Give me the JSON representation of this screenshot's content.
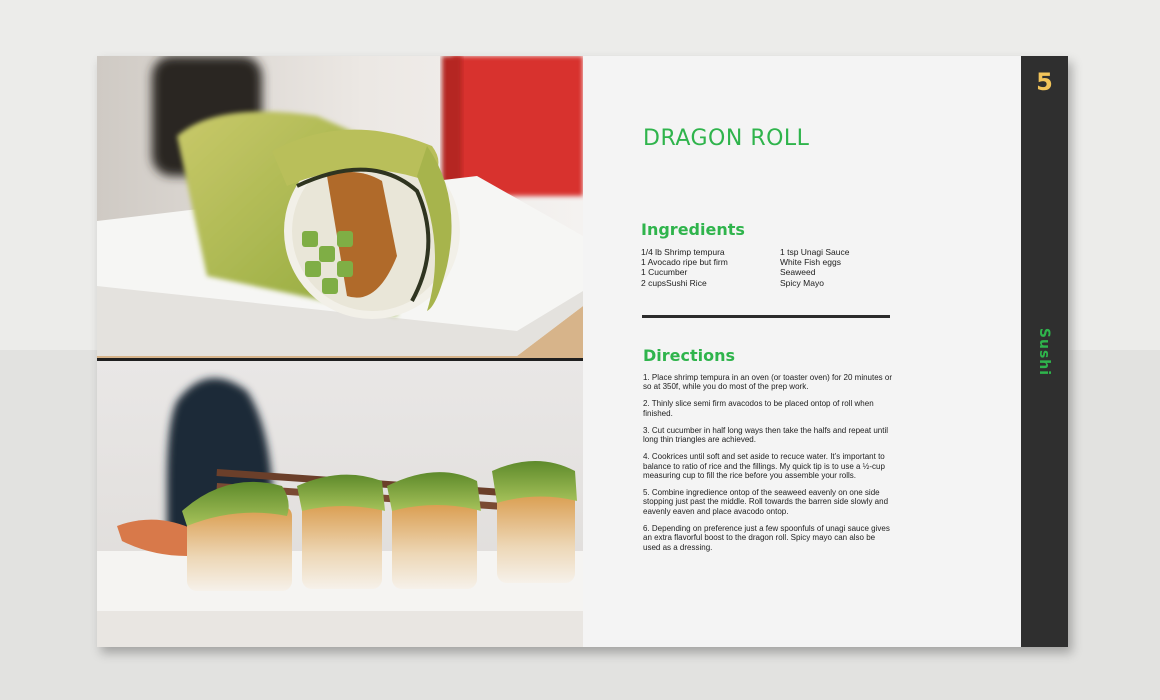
{
  "page": {
    "number": "5",
    "section": "Sushi",
    "accent_color": "#2fb44c",
    "number_color": "#f2c45a",
    "sidebar_color": "#2f2f2f"
  },
  "photos": {
    "top": {
      "subject": "dragon-roll-closeup-photo"
    },
    "bottom": {
      "subject": "dragon-roll-pieces-photo"
    }
  },
  "recipe": {
    "title": "DRAGON ROLL",
    "ingredients_heading": "Ingredients",
    "ingredients": [
      [
        "1/4 lb Shrimp tempura",
        "1 Avocado ripe but firm",
        "1 Cucumber",
        "2 cupsSushi Rice"
      ],
      [
        "1 tsp Unagi Sauce",
        "White Fish eggs",
        "Seaweed",
        "Spicy Mayo"
      ]
    ],
    "directions_heading": "Directions",
    "directions": [
      "1. Place shrimp tempura in an oven (or toaster oven) for 20 minutes or so at 350f, while you do most of the prep work.",
      "2. Thinly slice semi firm avacodos to be placed ontop of roll when finished.",
      "3. Cut cucumber in half long ways then take the halfs and repeat until long thin triangles are achieved.",
      "4. Cookrices until soft and set aside to recuce water. It’s important to balance to ratio of rice and the fillings. My quick tip is to use a ½-cup measuring cup to fill the rice before you assemble your rolls.",
      "5. Combine ingredience ontop of the seaweed eavenly on one side stopping just past the middle. Roll towards the barren side slowly and eavenly eaven and place avacodo ontop.",
      "6. Depending on preference just a few spoonfuls of unagi sauce gives an extra flavorful boost to the dragon roll. Spicy mayo can also be used as a dressing."
    ]
  }
}
